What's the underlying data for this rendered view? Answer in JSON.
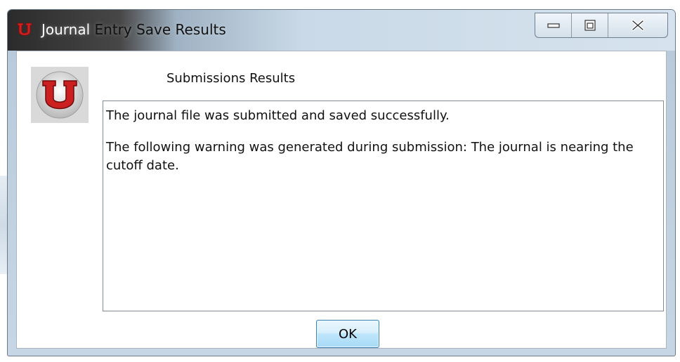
{
  "window": {
    "title_part1": "Journal",
    "title_part2": "Entry Save Results",
    "controls": {
      "minimize_icon": "minimize-icon",
      "maximize_icon": "maximize-icon",
      "close_icon": "close-icon"
    }
  },
  "dialog": {
    "heading": "Submissions Results",
    "message_lines": [
      "The journal file was submitted and saved successfully.",
      "The following warning was generated during submission: The journal is nearing the cutoff date."
    ],
    "ok_label": "OK",
    "logo_icon": "university-u-logo"
  },
  "colors": {
    "logo_red": "#cc1f1f",
    "button_border": "#3c7fb1"
  }
}
